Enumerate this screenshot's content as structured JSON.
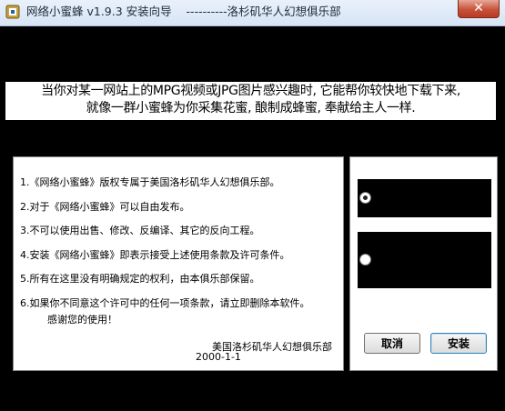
{
  "window": {
    "title": "网络小蜜蜂 v1.9.3 安装向导    ----------洛杉矶华人幻想俱乐部",
    "close_label": "✕"
  },
  "banner": {
    "line1": "当你对某一网站上的MPG视频或JPG图片感兴趣时, 它能帮你较快地下载下来,",
    "line2": "就像一群小蜜蜂为你采集花蜜, 酿制成蜂蜜, 奉献给主人一样."
  },
  "license": {
    "items": [
      "1.《网络小蜜蜂》版权专属于美国洛杉矶华人幻想俱乐部。",
      "2.对于《网络小蜜蜂》可以自由发布。",
      "3.不可以使用出售、修改、反编译、其它的反向工程。",
      "4.安装《网络小蜜蜂》即表示接受上述使用条款及许可条件。",
      "5.所有在这里没有明确规定的权利，由本俱乐部保留。",
      "6.如果你不同意这个许可中的任何一项条款，请立即删除本软件。"
    ],
    "thanks": "感谢您的使用！",
    "signature": "美国洛杉矶华人幻想俱乐部",
    "date": "2000-1-1"
  },
  "options": {
    "selected_index": 0
  },
  "buttons": {
    "cancel": "取消",
    "install": "安装"
  },
  "colors": {
    "background": "#000000",
    "panel": "#ffffff",
    "close_button": "#c8523a"
  }
}
